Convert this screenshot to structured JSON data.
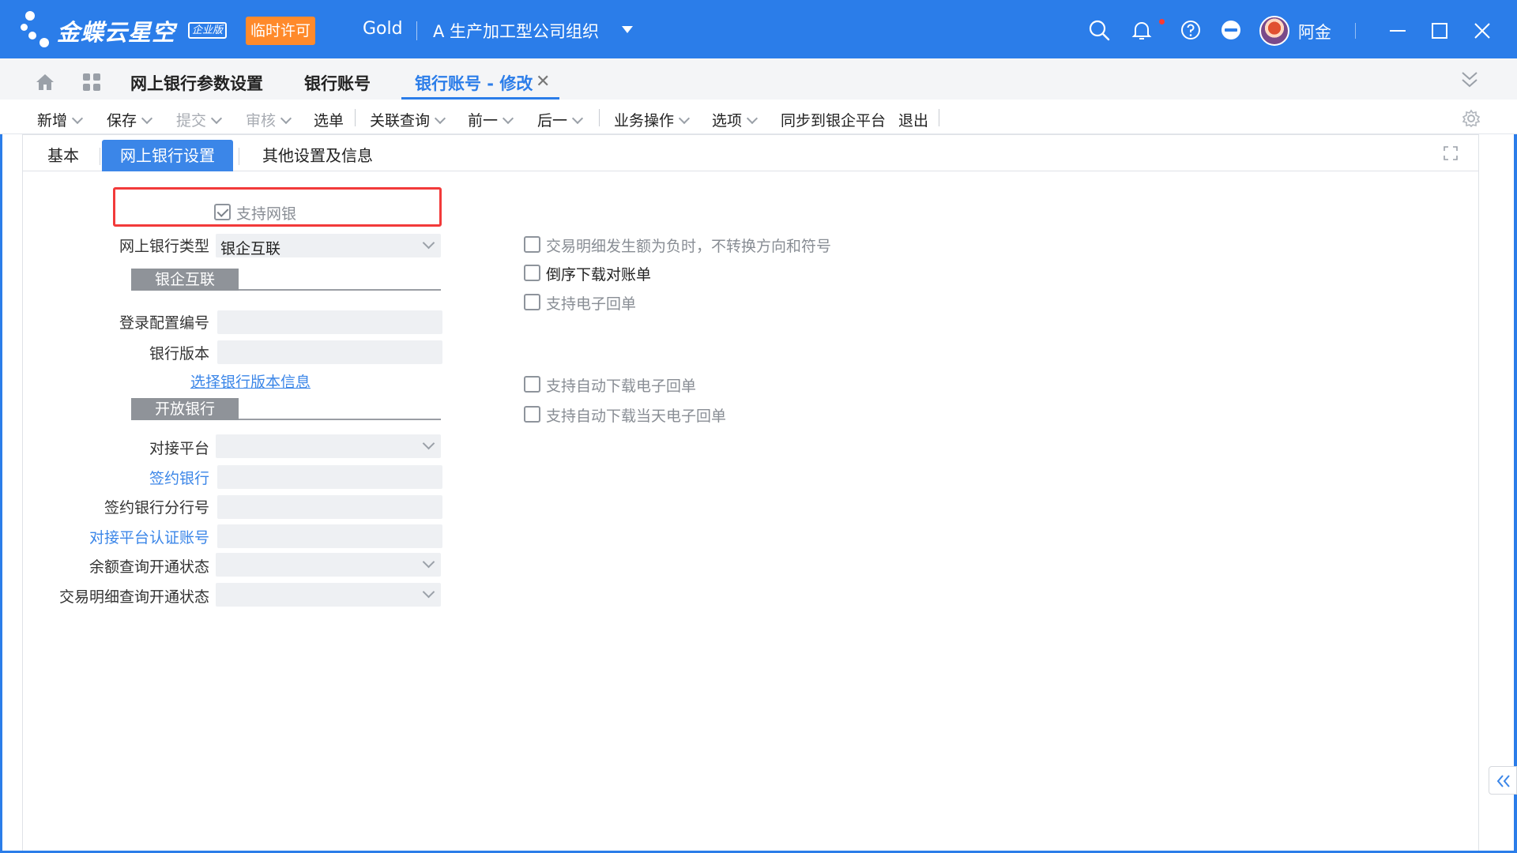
{
  "titlebar": {
    "brand": "金蝶云星空",
    "edition": "企业版",
    "license": "临时许可",
    "product": "Gold",
    "org": "A  生产加工型公司组织",
    "user": "阿金",
    "icons": [
      "search-icon",
      "bell-icon",
      "help-icon",
      "minus-circle-icon",
      "minimize-icon",
      "maximize-icon",
      "close-icon"
    ]
  },
  "tabs": {
    "home_icon": "home-icon",
    "apps_icon": "grid-icon",
    "items": [
      {
        "label": "网上银行参数设置"
      },
      {
        "label": "银行账号"
      },
      {
        "label": "银行账号 - 修改"
      }
    ]
  },
  "toolbar": {
    "new": "新增",
    "save": "保存",
    "submit": "提交",
    "audit": "审核",
    "select": "选单",
    "related": "关联查询",
    "prev": "前一",
    "next": "后一",
    "business": "业务操作",
    "options": "选项",
    "sync": "同步到银企平台",
    "exit": "退出"
  },
  "subtabs": [
    "基本",
    "网上银行设置",
    "其他设置及信息"
  ],
  "form": {
    "support_netbank": {
      "label": "支持网银",
      "checked": true
    },
    "netbank_type": {
      "label": "网上银行类型",
      "value": "银企互联"
    },
    "section1": "银企互联",
    "login_config": {
      "label": "登录配置编号",
      "value": ""
    },
    "bank_version": {
      "label": "银行版本",
      "value": ""
    },
    "select_version_link": "选择银行版本信息",
    "section2": "开放银行",
    "platform": {
      "label": "对接平台",
      "value": ""
    },
    "contract_bank": {
      "label": "签约银行",
      "value": ""
    },
    "contract_branch": {
      "label": "签约银行分行号",
      "value": ""
    },
    "platform_account": {
      "label": "对接平台认证账号",
      "value": ""
    },
    "balance_status": {
      "label": "余额查询开通状态",
      "value": ""
    },
    "detail_status": {
      "label": "交易明细查询开通状态",
      "value": ""
    }
  },
  "options": {
    "negative_no_convert": {
      "label": "交易明细发生额为负时，不转换方向和符号",
      "checked": false
    },
    "reverse_download": {
      "label": "倒序下载对账单",
      "checked": false
    },
    "support_ereceipt": {
      "label": "支持电子回单",
      "checked": false
    },
    "auto_download_ereceipt": {
      "label": "支持自动下载电子回单",
      "checked": false
    },
    "auto_download_today": {
      "label": "支持自动下载当天电子回单",
      "checked": false
    }
  },
  "colors": {
    "primary": "#2b7de9",
    "license": "#ff8a2b",
    "highlight": "#f23a3a",
    "link": "#3b86e8"
  }
}
